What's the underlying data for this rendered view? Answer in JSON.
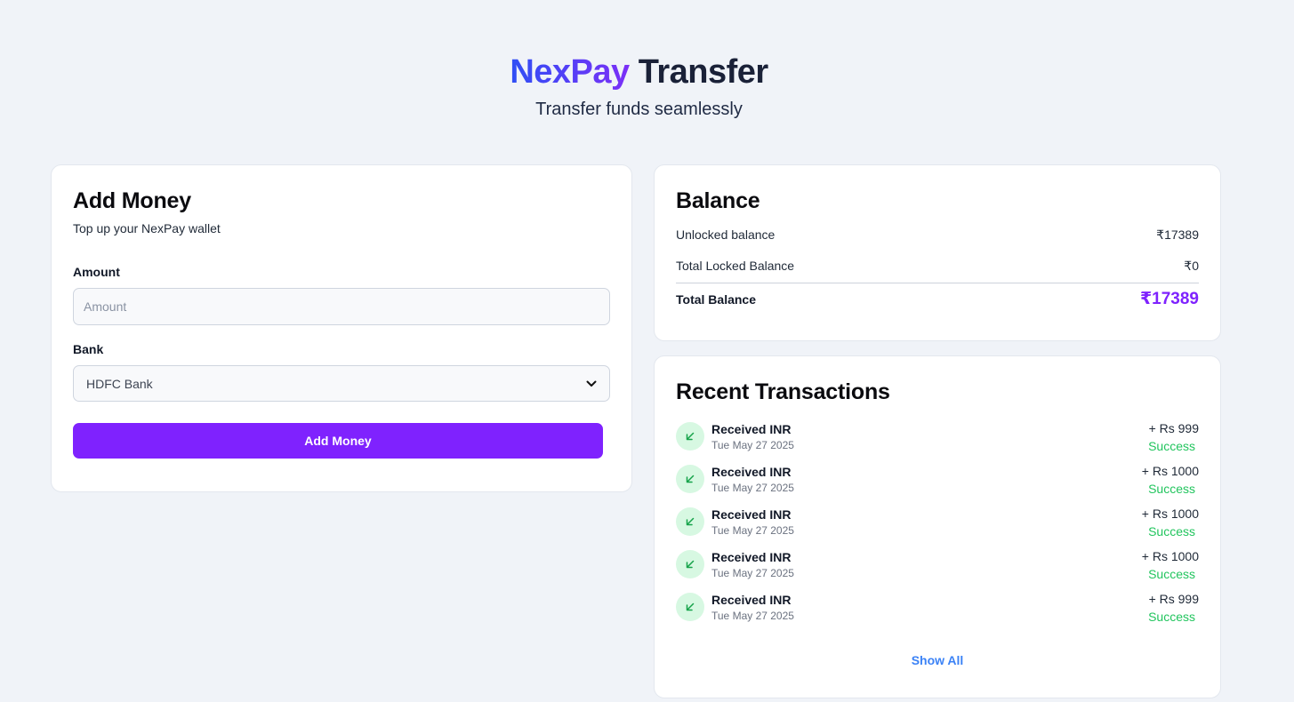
{
  "header": {
    "brand": "NexPay",
    "title_rest": "Transfer",
    "subtitle": "Transfer funds seamlessly",
    "brand_gradient": [
      "#2f4ff5",
      "#7b2ff7"
    ]
  },
  "add_money": {
    "title": "Add Money",
    "subtitle": "Top up your NexPay wallet",
    "amount_label": "Amount",
    "amount_placeholder": "Amount",
    "amount_value": "",
    "bank_label": "Bank",
    "bank_selected": "HDFC Bank",
    "button_label": "Add Money",
    "button_color": "#7f22fe"
  },
  "balance": {
    "title": "Balance",
    "rows": [
      {
        "label": "Unlocked balance",
        "value": "₹17389"
      },
      {
        "label": "Total Locked Balance",
        "value": "₹0"
      }
    ],
    "total_label": "Total Balance",
    "total_value": "₹17389",
    "accent_color": "#7f22fe"
  },
  "transactions": {
    "title": "Recent Transactions",
    "items": [
      {
        "title": "Received INR",
        "date": "Tue May 27 2025",
        "amount": "+ Rs 999",
        "status": "Success",
        "icon": "arrow-down-left-icon"
      },
      {
        "title": "Received INR",
        "date": "Tue May 27 2025",
        "amount": "+ Rs 1000",
        "status": "Success",
        "icon": "arrow-down-left-icon"
      },
      {
        "title": "Received INR",
        "date": "Tue May 27 2025",
        "amount": "+ Rs 1000",
        "status": "Success",
        "icon": "arrow-down-left-icon"
      },
      {
        "title": "Received INR",
        "date": "Tue May 27 2025",
        "amount": "+ Rs 1000",
        "status": "Success",
        "icon": "arrow-down-left-icon"
      },
      {
        "title": "Received INR",
        "date": "Tue May 27 2025",
        "amount": "+ Rs 999",
        "status": "Success",
        "icon": "arrow-down-left-icon"
      }
    ],
    "show_all_label": "Show All",
    "status_color": "#22c55e",
    "link_color": "#3b82f6"
  }
}
